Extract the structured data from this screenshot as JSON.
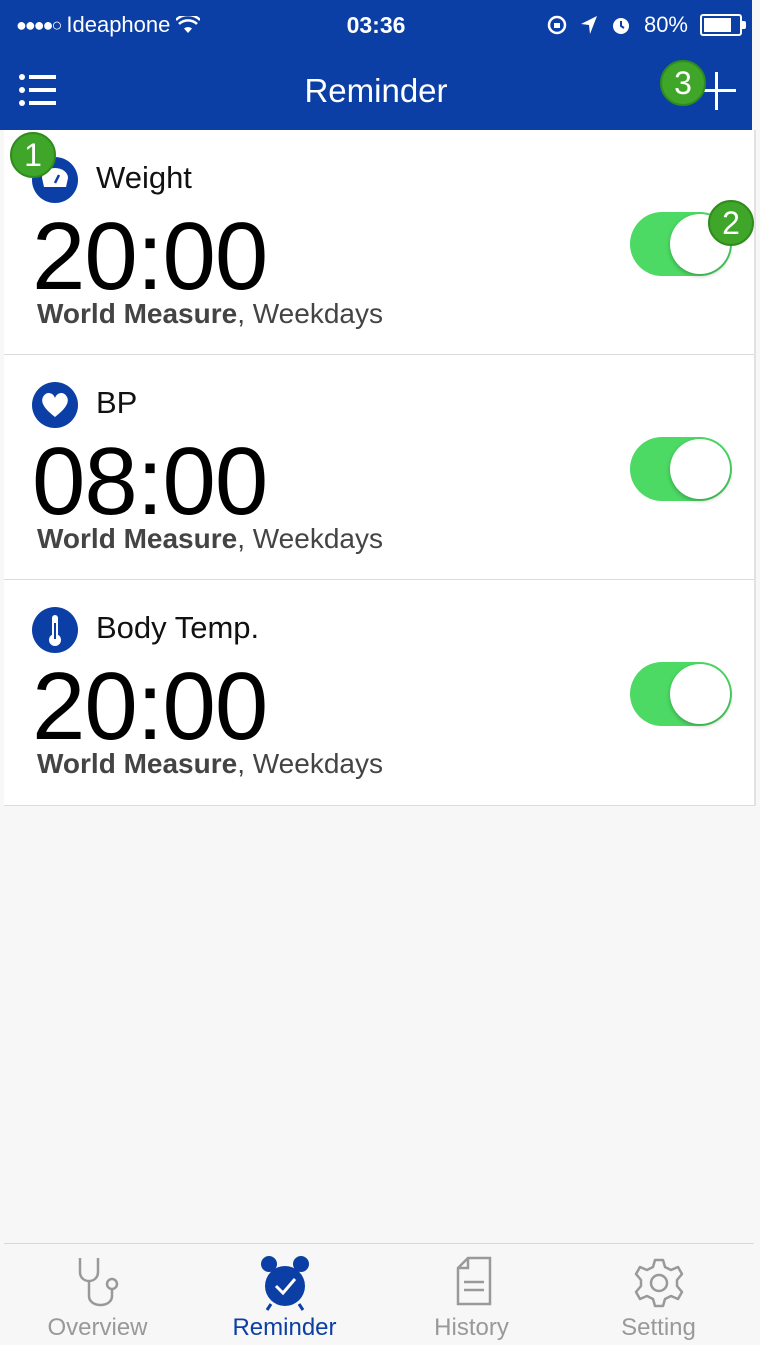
{
  "status_bar": {
    "signal": "●●●●○",
    "carrier": "Ideaphone",
    "time": "03:36",
    "battery": "80%",
    "battery_level": 0.8
  },
  "navbar": {
    "title": "Reminder",
    "menu_icon": "list-icon",
    "add_icon": "plus-icon"
  },
  "badges": [
    "1",
    "2",
    "3"
  ],
  "reminders": [
    {
      "icon": "scale-icon",
      "name": "Weight",
      "time": "20:00",
      "user": "World Measure",
      "repeat": ", Weekdays",
      "enabled": true
    },
    {
      "icon": "heart-icon",
      "name": "BP",
      "time": "08:00",
      "user": "World Measure",
      "repeat": ", Weekdays",
      "enabled": true
    },
    {
      "icon": "thermometer-icon",
      "name": "Body Temp.",
      "time": "20:00",
      "user": "World Measure",
      "repeat": ", Weekdays",
      "enabled": true
    }
  ],
  "tabs": [
    {
      "label": "Overview",
      "icon": "stethoscope-icon",
      "active": false
    },
    {
      "label": "Reminder",
      "icon": "alarm-clock-icon",
      "active": true
    },
    {
      "label": "History",
      "icon": "document-icon",
      "active": false
    },
    {
      "label": "Setting",
      "icon": "gear-icon",
      "active": false
    }
  ],
  "colors": {
    "brand": "#0b3fa5",
    "toggle_on": "#4cd964",
    "badge": "#3fa629"
  }
}
